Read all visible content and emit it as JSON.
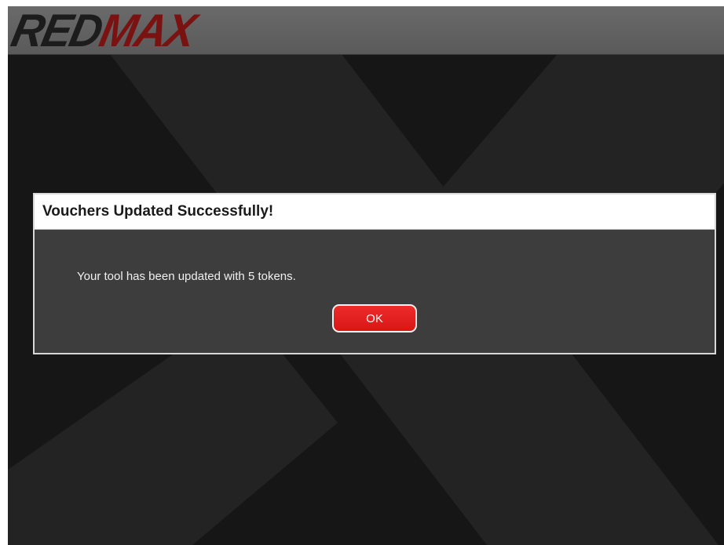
{
  "header": {
    "logo_red": "RED",
    "logo_max": "MAX"
  },
  "dialog": {
    "title": "Vouchers Updated Successfully!",
    "message": "Your tool has been updated with 5 tokens.",
    "ok_label": "OK"
  },
  "colors": {
    "background": "#161616",
    "header": "#5f5f5f",
    "dialog_body": "#3d3d3d",
    "dialog_title_bg": "#ffffff",
    "ok_button": "#e31f1f",
    "brand_dark_red": "#7a1212"
  },
  "icons": {
    "background_watermark": "x-watermark-icon"
  }
}
